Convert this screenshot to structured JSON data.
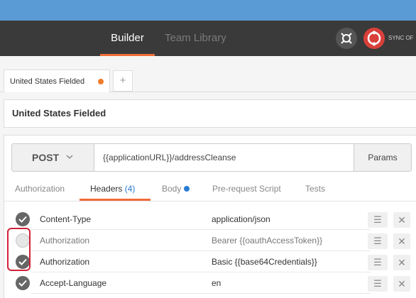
{
  "nav": {
    "builder_label": "Builder",
    "team_library_label": "Team Library",
    "sync_label": "SYNC OF",
    "accent_color": "#f26b3a"
  },
  "request_tab": {
    "label": "United States Fielded",
    "add_label": "+"
  },
  "request_name": "United States Fielded",
  "url_bar": {
    "method": "POST",
    "url": "{{applicationURL}}/addressCleanse",
    "params_label": "Params"
  },
  "sub_tabs": {
    "authorization": "Authorization",
    "headers": "Headers",
    "headers_count": "(4)",
    "body": "Body",
    "prerequest": "Pre-request Script",
    "tests": "Tests"
  },
  "headers": [
    {
      "enabled": true,
      "key": "Content-Type",
      "value": "application/json"
    },
    {
      "enabled": false,
      "key": "Authorization",
      "value": "Bearer {{oauthAccessToken}}"
    },
    {
      "enabled": true,
      "key": "Authorization",
      "value": "Basic {{base64Credentials}}"
    },
    {
      "enabled": true,
      "key": "Accept-Language",
      "value": "en"
    }
  ],
  "row_menu_glyph": "☰",
  "row_delete_glyph": "✕"
}
